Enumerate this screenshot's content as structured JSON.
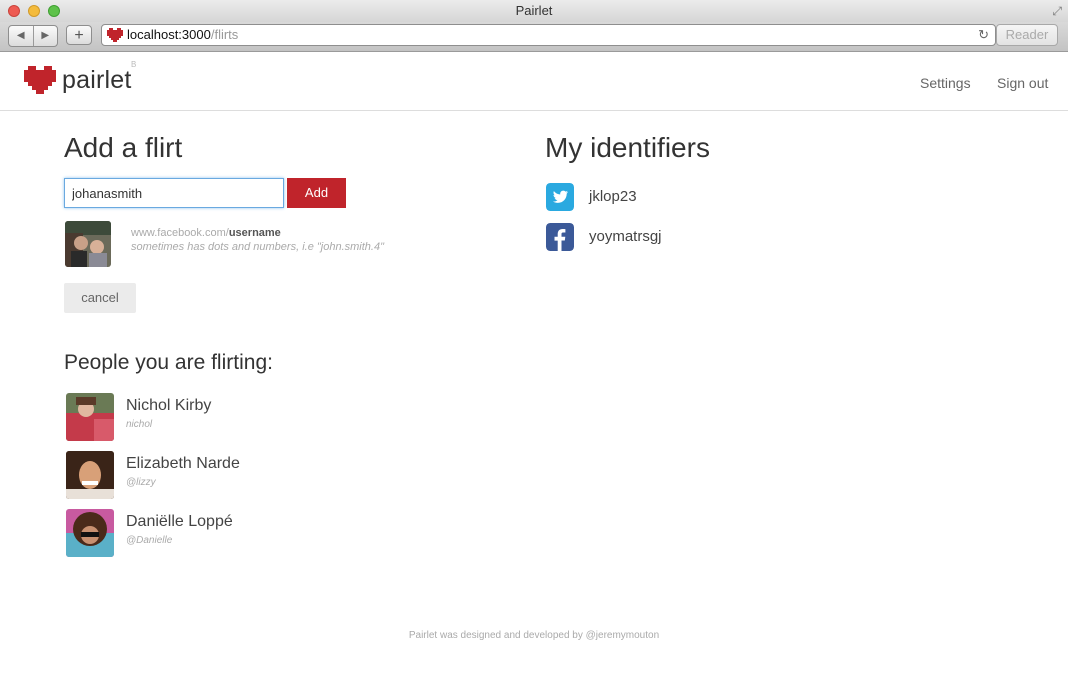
{
  "window": {
    "title": "Pairlet"
  },
  "browser": {
    "url_host": "localhost:3000",
    "url_path": "/flirts",
    "reader_label": "Reader"
  },
  "header": {
    "brand": "pairlet",
    "beta_mark": "B",
    "nav": {
      "settings": "Settings",
      "signout": "Sign out"
    },
    "accent": "#c0242b"
  },
  "add_flirt": {
    "title": "Add a flirt",
    "input_value": "johanasmith",
    "add_label": "Add",
    "hint_prefix": "www.facebook.com/",
    "hint_bold": "username",
    "hint_note": "sometimes has dots and numbers, i.e \"john.smith.4\"",
    "cancel_label": "cancel"
  },
  "people": {
    "title": "People you are flirting:",
    "items": [
      {
        "name": "Nichol Kirby",
        "handle": "nichol"
      },
      {
        "name": "Elizabeth Narde",
        "handle": "@lizzy"
      },
      {
        "name": "Daniëlle Loppé",
        "handle": "@Danielle"
      }
    ]
  },
  "identifiers": {
    "title": "My identifiers",
    "items": [
      {
        "service": "twitter",
        "icon": "twitter-icon",
        "value": "jklop23",
        "color": "#2aa9e0"
      },
      {
        "service": "facebook",
        "icon": "facebook-icon",
        "value": "yoymatrsgj",
        "color": "#3b5998"
      }
    ]
  },
  "footer": {
    "text": "Pairlet was designed and developed by @jeremymouton"
  }
}
